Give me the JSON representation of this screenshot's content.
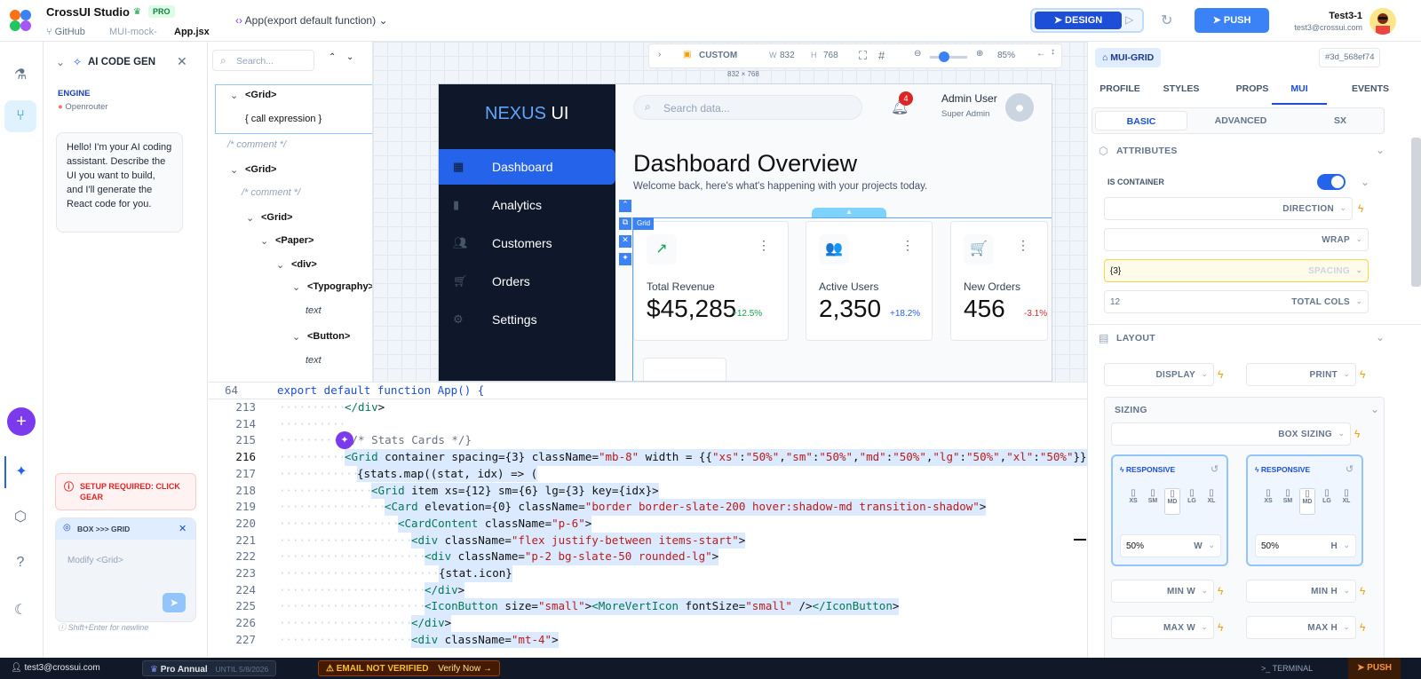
{
  "app": {
    "name": "CrossUI Studio",
    "plan_badge": "PRO",
    "breadcrumb": [
      "GitHub",
      "MUI-mock-",
      "App.jsx"
    ],
    "function_selector": "App(export default function)",
    "design_button": "DESIGN",
    "push_button": "PUSH",
    "user_name": "Test3-1",
    "user_email": "test3@crossui.com"
  },
  "ai_panel": {
    "title": "AI CODE GEN",
    "engine_label": "ENGINE",
    "engine_value": "Openrouter",
    "assistant_message": "Hello! I'm your AI coding assistant. Describe the UI you want to build, and I'll generate the React code for you.",
    "setup_warning": "SETUP REQUIRED: CLICK GEAR",
    "context_chip": "BOX >>> GRID",
    "input_placeholder": "Modify <Grid>",
    "hint": "Shift+Enter for newline"
  },
  "tree": {
    "search_placeholder": "Search...",
    "nodes": [
      {
        "label": "<Grid>",
        "type": "tag"
      },
      {
        "label": "{ call expression }",
        "type": "expr"
      },
      {
        "label": "/* comment */",
        "type": "comment"
      },
      {
        "label": "<Grid>",
        "type": "tag"
      },
      {
        "label": "/* comment */",
        "type": "comment"
      },
      {
        "label": "<Grid>",
        "type": "tag"
      },
      {
        "label": "<Paper>",
        "type": "tag"
      },
      {
        "label": "<div>",
        "type": "tag"
      },
      {
        "label": "<Typography>",
        "type": "tag"
      },
      {
        "label": "text",
        "type": "text"
      },
      {
        "label": "<Button>",
        "type": "tag"
      },
      {
        "label": "text",
        "type": "text"
      }
    ]
  },
  "canvas": {
    "device": "CUSTOM",
    "w_label": "W",
    "w_value": "832",
    "h_label": "H",
    "h_value": "768",
    "zoom": "85%",
    "size_caption": "832 × 768",
    "grid_tag": "Grid"
  },
  "preview": {
    "brand_a": "NEXUS",
    "brand_b": " UI",
    "nav": [
      "Dashboard",
      "Analytics",
      "Customers",
      "Orders",
      "Settings"
    ],
    "search_placeholder": "Search data...",
    "notifications": "4",
    "admin_name": "Admin User",
    "admin_role": "Super Admin",
    "heading": "Dashboard Overview",
    "subheading": "Welcome back, here's what's happening with your projects today.",
    "cards": [
      {
        "label": "Total Revenue",
        "value": "$45,285",
        "change": "+12.5%",
        "color": "#16a34a",
        "icon": "↗"
      },
      {
        "label": "Active Users",
        "value": "2,350",
        "change": "+18.2%",
        "color": "#2563eb",
        "icon": "👥"
      },
      {
        "label": "New Orders",
        "value": "456",
        "change": "-3.1%",
        "color": "#dc2626",
        "icon": "🛒"
      }
    ]
  },
  "editor": {
    "function_line_no": "64",
    "function_line": "export default function App() {",
    "lines": [
      {
        "no": "213",
        "text": "</div>"
      },
      {
        "no": "214",
        "text": ""
      },
      {
        "no": "215",
        "text": "{/* Stats Cards */}"
      },
      {
        "no": "216",
        "text": "<Grid container spacing={3} className=\"mb-8\" width = {{\"xs\":\"50%\",\"sm\":\"50%\",\"md\":\"50%\",\"lg\":\"50%\",\"xl\":\"50%\"}}"
      },
      {
        "no": "217",
        "text": "{stats.map((stat, idx) => ("
      },
      {
        "no": "218",
        "text": "<Grid item xs={12} sm={6} lg={3} key={idx}>"
      },
      {
        "no": "219",
        "text": "<Card elevation={0} className=\"border border-slate-200 hover:shadow-md transition-shadow\">"
      },
      {
        "no": "220",
        "text": "<CardContent className=\"p-6\">"
      },
      {
        "no": "221",
        "text": "<div className=\"flex justify-between items-start\">"
      },
      {
        "no": "222",
        "text": "<div className=\"p-2 bg-slate-50 rounded-lg\">"
      },
      {
        "no": "223",
        "text": "{stat.icon}"
      },
      {
        "no": "224",
        "text": "</div>"
      },
      {
        "no": "225",
        "text": "<IconButton size=\"small\"><MoreVertIcon fontSize=\"small\" /></IconButton>"
      },
      {
        "no": "226",
        "text": "</div>"
      },
      {
        "no": "227",
        "text": "<div className=\"mt-4\">"
      }
    ]
  },
  "props": {
    "component": "MUI-GRID",
    "component_id": "#3d_568ef74",
    "tabs": [
      "PROFILE",
      "STYLES",
      "PROPS",
      "MUI",
      "EVENTS"
    ],
    "subtabs": [
      "BASIC",
      "ADVANCED",
      "SX"
    ],
    "attributes_title": "ATTRIBUTES",
    "is_container_label": "IS CONTAINER",
    "direction_label": "DIRECTION",
    "wrap_label": "WRAP",
    "spacing_value": "{3}",
    "spacing_label": "SPACING",
    "total_cols_value": "12",
    "total_cols_label": "TOTAL COLS",
    "layout_title": "LAYOUT",
    "display_label": "DISPLAY",
    "print_label": "PRINT",
    "sizing_title": "SIZING",
    "box_sizing_label": "BOX SIZING",
    "responsive_label": "RESPONSIVE",
    "breakpoints": [
      "XS",
      "SM",
      "MD",
      "LG",
      "XL"
    ],
    "width_value": "50%",
    "width_unit": "W",
    "height_value": "50%",
    "height_unit": "H",
    "min_w": "MIN W",
    "min_h": "MIN H",
    "max_w": "MAX W",
    "max_h": "MAX H"
  },
  "status": {
    "email": "test3@crossui.com",
    "plan": "Pro Annual",
    "until": "UNTIL 5/8/2026",
    "warning": "EMAIL NOT VERIFIED",
    "verify": "Verify Now →",
    "terminal": "TERMINAL",
    "push": "PUSH"
  }
}
